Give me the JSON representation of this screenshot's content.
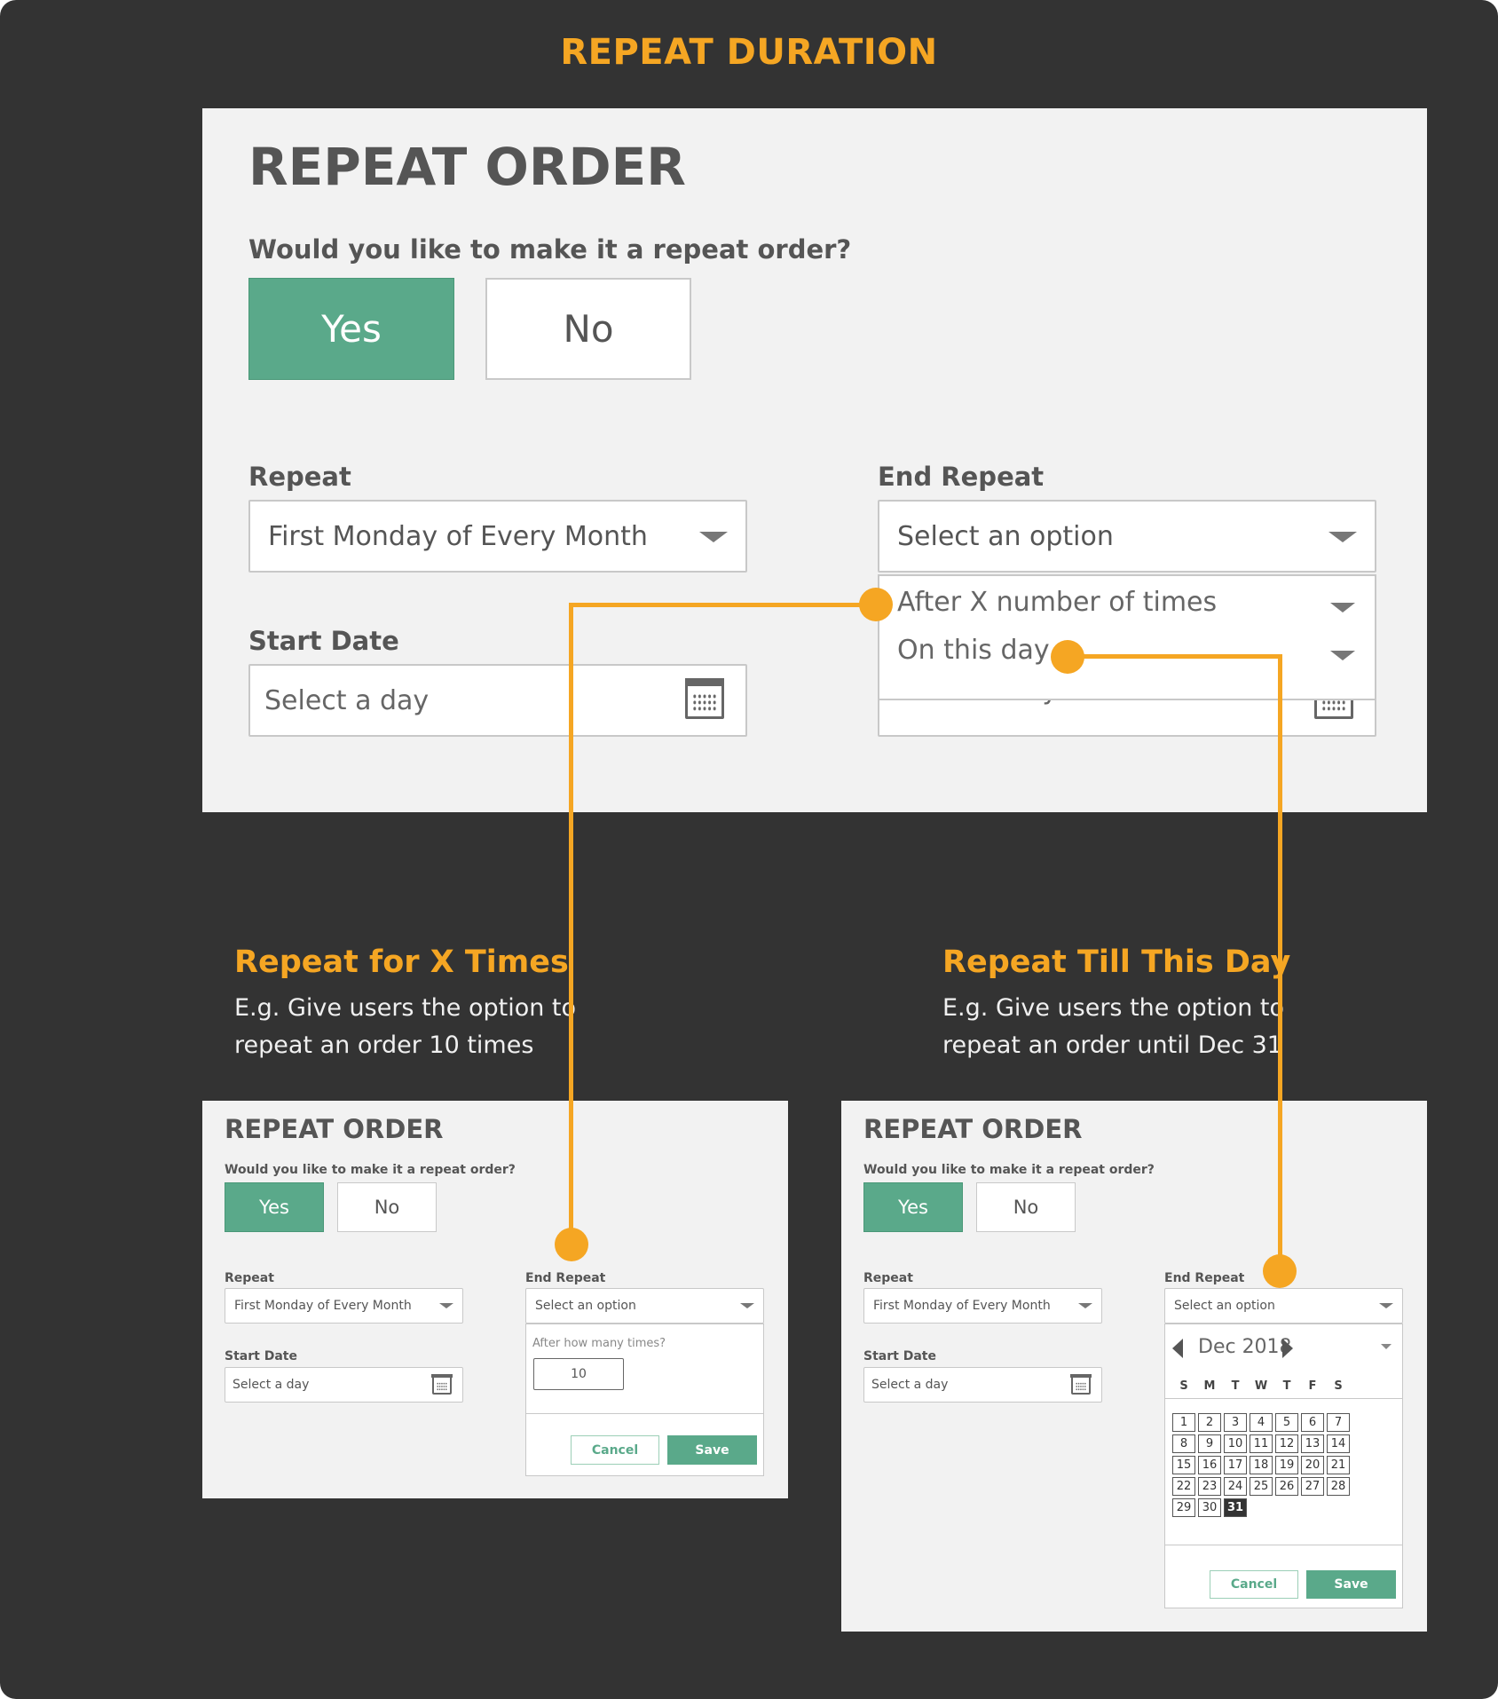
{
  "header": {
    "title": "REPEAT DURATION"
  },
  "main_form": {
    "title": "REPEAT ORDER",
    "question": "Would you like to make it a repeat order?",
    "yes_label": "Yes",
    "no_label": "No",
    "repeat_label": "Repeat",
    "repeat_value": "First Monday of Every Month",
    "start_date_label": "Start Date",
    "start_date_placeholder": "Select a day",
    "end_repeat_label": "End Repeat",
    "end_repeat_placeholder": "Select an option",
    "end_repeat_options": [
      "After X number of times",
      "On this day"
    ],
    "hidden_field_text": "Select a day"
  },
  "section_times": {
    "title": "Repeat for X Times",
    "desc_line1": "E.g. Give users the option to",
    "desc_line2": "repeat an order 10 times"
  },
  "section_day": {
    "title": "Repeat Till This Day",
    "desc_line1": "E.g. Give users the option to",
    "desc_line2": "repeat an order until Dec 31"
  },
  "mini_times": {
    "title": "REPEAT ORDER",
    "question": "Would you like to make it a repeat order?",
    "yes_label": "Yes",
    "no_label": "No",
    "repeat_label": "Repeat",
    "repeat_value": "First Monday of Every Month",
    "start_date_label": "Start Date",
    "start_date_placeholder": "Select a day",
    "end_repeat_label": "End Repeat",
    "end_repeat_placeholder": "Select an option",
    "times_prompt": "After how many times?",
    "times_value": "10",
    "cancel_label": "Cancel",
    "save_label": "Save"
  },
  "mini_day": {
    "title": "REPEAT ORDER",
    "question": "Would you like to make it a repeat order?",
    "yes_label": "Yes",
    "no_label": "No",
    "repeat_label": "Repeat",
    "repeat_value": "First Monday of Every Month",
    "start_date_label": "Start Date",
    "start_date_placeholder": "Select a day",
    "end_repeat_label": "End Repeat",
    "end_repeat_placeholder": "Select an option",
    "calendar": {
      "month_label": "Dec 2018",
      "weekdays": [
        "S",
        "M",
        "T",
        "W",
        "T",
        "F",
        "S"
      ],
      "days": [
        "1",
        "2",
        "3",
        "4",
        "5",
        "6",
        "7",
        "8",
        "9",
        "10",
        "11",
        "12",
        "13",
        "14",
        "15",
        "16",
        "17",
        "18",
        "19",
        "20",
        "21",
        "22",
        "23",
        "24",
        "25",
        "26",
        "27",
        "28",
        "29",
        "30",
        "31"
      ],
      "selected_day": "31"
    },
    "cancel_label": "Cancel",
    "save_label": "Save"
  },
  "colors": {
    "accent": "#f5a623",
    "primary_green": "#5aa98a",
    "background": "#333333",
    "panel": "#f2f2f2"
  }
}
